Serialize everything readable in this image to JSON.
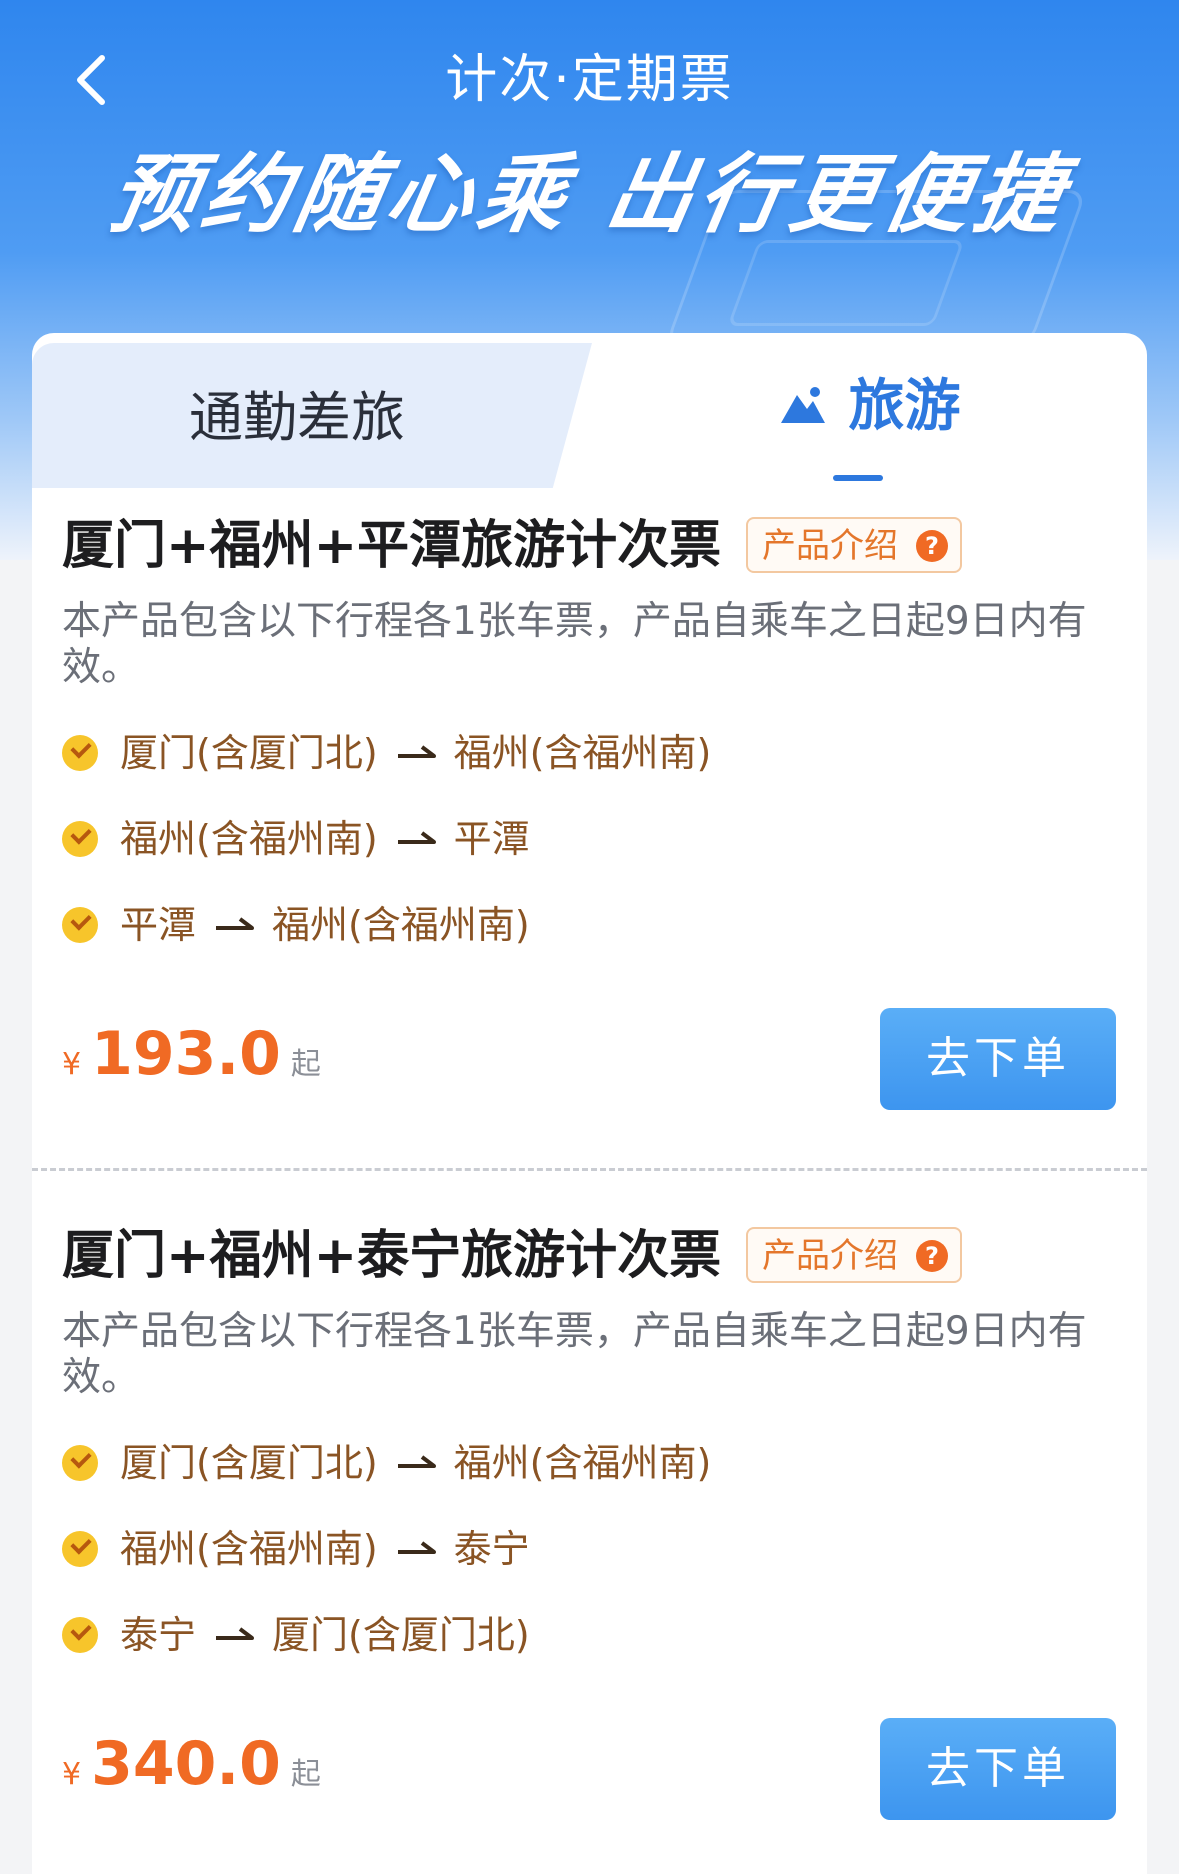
{
  "header": {
    "title": "计次·定期票",
    "slogan": "预约随心乘 出行更便捷"
  },
  "tabs": [
    {
      "label": "通勤差旅",
      "active": false
    },
    {
      "label": "旅游",
      "active": true,
      "icon": "mountain-icon"
    }
  ],
  "colors": {
    "accent": "#2d78de",
    "price": "#f06a24",
    "route_text": "#8a5424",
    "button": "#3d95ef"
  },
  "products": [
    {
      "title": "厦门+福州+平潭旅游计次票",
      "intro_label": "产品介绍",
      "description": "本产品包含以下行程各1张车票，产品自乘车之日起9日内有效。",
      "routes": [
        {
          "from": "厦门(含厦门北)",
          "to": "福州(含福州南)"
        },
        {
          "from": "福州(含福州南)",
          "to": "平潭"
        },
        {
          "from": "平潭",
          "to": "福州(含福州南)"
        }
      ],
      "currency": "¥",
      "price": "193.0",
      "price_suffix": "起",
      "order_label": "去下单"
    },
    {
      "title": "厦门+福州+泰宁旅游计次票",
      "intro_label": "产品介绍",
      "description": "本产品包含以下行程各1张车票，产品自乘车之日起9日内有效。",
      "routes": [
        {
          "from": "厦门(含厦门北)",
          "to": "福州(含福州南)"
        },
        {
          "from": "福州(含福州南)",
          "to": "泰宁"
        },
        {
          "from": "泰宁",
          "to": "厦门(含厦门北)"
        }
      ],
      "currency": "¥",
      "price": "340.0",
      "price_suffix": "起",
      "order_label": "去下单"
    }
  ]
}
